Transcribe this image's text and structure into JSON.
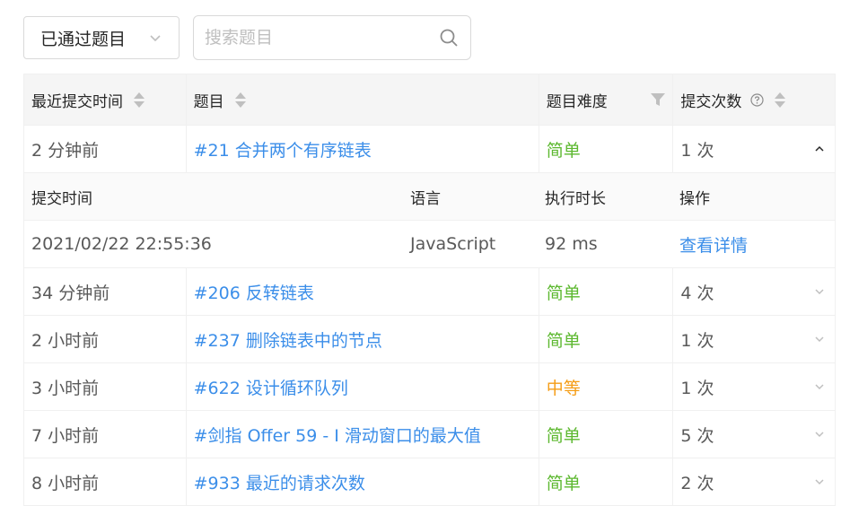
{
  "filter": {
    "label": "已通过题目"
  },
  "search": {
    "placeholder": "搜索题目"
  },
  "table": {
    "headers": {
      "recent_time": "最近提交时间",
      "title": "题目",
      "difficulty": "题目难度",
      "submissions": "提交次数"
    },
    "rows": [
      {
        "time": "2 分钟前",
        "title": "#21 合并两个有序链表",
        "difficulty": "简单",
        "count": "1 次"
      },
      {
        "time": "34 分钟前",
        "title": "#206 反转链表",
        "difficulty": "简单",
        "count": "4 次"
      },
      {
        "time": "2 小时前",
        "title": "#237 删除链表中的节点",
        "difficulty": "简单",
        "count": "1 次"
      },
      {
        "time": "3 小时前",
        "title": "#622 设计循环队列",
        "difficulty": "中等",
        "count": "1 次"
      },
      {
        "time": "7 小时前",
        "title": "#剑指 Offer 59 - I 滑动窗口的最大值",
        "difficulty": "简单",
        "count": "5 次"
      },
      {
        "time": "8 小时前",
        "title": "#933 最近的请求次数",
        "difficulty": "简单",
        "count": "2 次"
      }
    ],
    "expanded": {
      "headers": {
        "submit_time": "提交时间",
        "language": "语言",
        "runtime": "执行时长",
        "action": "操作"
      },
      "row": {
        "submit_time": "2021/02/22 22:55:36",
        "language": "JavaScript",
        "runtime": "92 ms",
        "action": "查看详情"
      }
    }
  },
  "colors": {
    "link": "#3b8ee9",
    "easy": "#5cb82f",
    "medium": "#f59d17",
    "header_bg": "#f5f5f5"
  },
  "icons": {
    "filter_chevron": "chevron-down-icon",
    "search": "search-icon",
    "sort": "sort-icon",
    "filter": "funnel-icon",
    "help": "question-circle-icon",
    "collapse": "chevron-up-icon",
    "expand": "chevron-down-icon"
  }
}
